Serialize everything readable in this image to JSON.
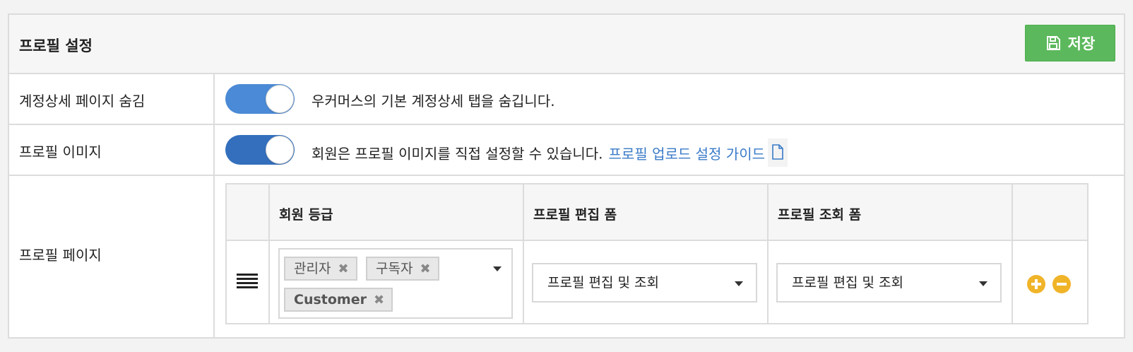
{
  "header": {
    "title": "프로필 설정",
    "save_label": "저장"
  },
  "rows": [
    {
      "label": "계정상세 페이지 숨김",
      "toggle_on": true,
      "toggle_color": "#4a8ad6",
      "description": "우커머스의 기본 계정상세 탭을 숨깁니다."
    },
    {
      "label": "프로필 이미지",
      "toggle_on": true,
      "toggle_color": "#336fbd",
      "description": "회원은 프로필 이미지를 직접 설정할 수 있습니다.",
      "link_text": "프로필 업로드 설정 가이드",
      "link_icon": "document-icon"
    },
    {
      "label": "프로필 페이지"
    }
  ],
  "profile_table": {
    "columns": [
      "회원 등급",
      "프로필 편집 폼",
      "프로필 조회 폼"
    ],
    "row": {
      "member_grades": [
        "관리자",
        "구독자",
        "Customer"
      ],
      "edit_form": "프로필 편집 및 조회",
      "view_form": "프로필 편집 및 조회"
    }
  },
  "colors": {
    "save_button": "#5cb85c",
    "link": "#3a7bc8",
    "action_buttons": "#f0b429"
  }
}
